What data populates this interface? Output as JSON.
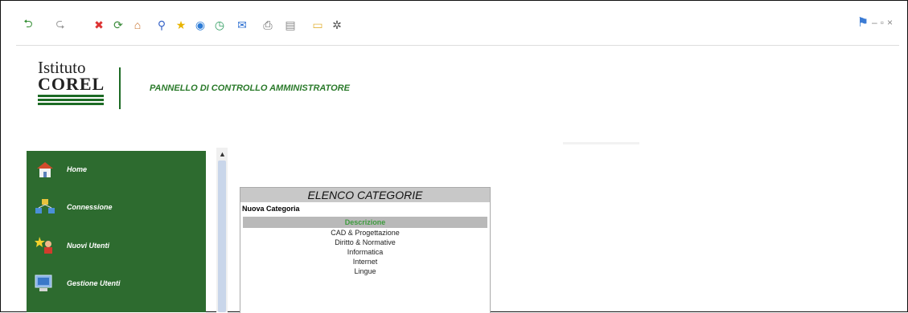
{
  "toolbar": {
    "buttons": [
      {
        "name": "back-icon",
        "glyph": "⮌",
        "color": "#2e8b2e"
      },
      {
        "name": "forward-icon",
        "glyph": "⮎",
        "color": "#999999"
      },
      {
        "name": "stop-icon",
        "glyph": "✖",
        "color": "#d33"
      },
      {
        "name": "refresh-icon",
        "glyph": "⟳",
        "color": "#3a8a3a"
      },
      {
        "name": "home-icon",
        "glyph": "⌂",
        "color": "#c8702a"
      },
      {
        "name": "search-icon",
        "glyph": "⚲",
        "color": "#3a66c8"
      },
      {
        "name": "favorites-icon",
        "glyph": "★",
        "color": "#e8b400"
      },
      {
        "name": "media-icon",
        "glyph": "◉",
        "color": "#2b7bd6"
      },
      {
        "name": "history-icon",
        "glyph": "◷",
        "color": "#2c9c5e"
      },
      {
        "name": "mail-icon",
        "glyph": "✉",
        "color": "#2c6fd1"
      },
      {
        "name": "print-icon",
        "glyph": "⎙",
        "color": "#666666"
      },
      {
        "name": "edit-icon",
        "glyph": "▤",
        "color": "#888888"
      },
      {
        "name": "notes-icon",
        "glyph": "▭",
        "color": "#e3b43c"
      },
      {
        "name": "tools-icon",
        "glyph": "✲",
        "color": "#555555"
      }
    ],
    "windows_logo_icon": "windows-flag-icon"
  },
  "header": {
    "logo_line1": "Istituto",
    "logo_line2": "COREL",
    "admin_title": "PANNELLO DI CONTROLLO AMMINISTRATORE"
  },
  "sidebar": {
    "items": [
      {
        "label": "Home",
        "icon": "home-icon"
      },
      {
        "label": "Connessione",
        "icon": "network-icon"
      },
      {
        "label": "Nuovi Utenti",
        "icon": "new-user-icon"
      },
      {
        "label": "Gestione Utenti",
        "icon": "computer-icon"
      }
    ],
    "bg": "#2d6b2f"
  },
  "categories": {
    "title": "ELENCO CATEGORIE",
    "new_link": "Nuova Categoria",
    "column_header": "Descrizione",
    "rows": [
      "CAD & Progettazione",
      "Diritto & Normative",
      "Informatica",
      "Internet",
      "Lingue"
    ]
  }
}
